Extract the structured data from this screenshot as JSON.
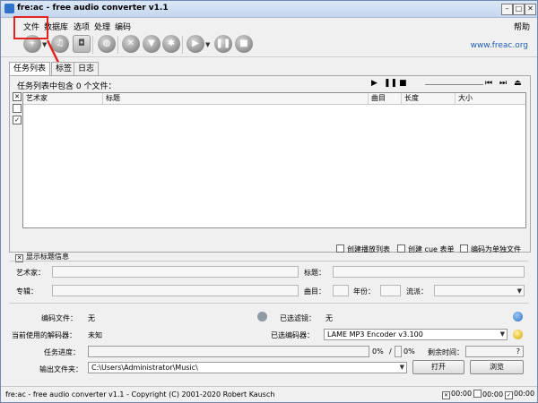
{
  "window": {
    "title": "fre:ac - free audio converter v1.1"
  },
  "menu": {
    "file": "文件",
    "database": "数据库",
    "options": "选项",
    "process": "处理",
    "encode": "编码",
    "help": "帮助"
  },
  "toolbar": {
    "website": "www.freac.org"
  },
  "tabs": {
    "joblist": "任务列表",
    "tags": "标签",
    "log": "日志"
  },
  "joblist": {
    "status": "任务列表中包含 0 个文件：",
    "columns": {
      "artist": "艺术家",
      "title": "标题",
      "track": "曲目",
      "length": "长度",
      "size": "大小"
    },
    "options": {
      "playlist": "创建播放列表",
      "cue": "创建 cue 表单",
      "single": "编码为单独文件"
    }
  },
  "tag_info": {
    "header": "显示标题信息",
    "artist": "艺术家：",
    "title": "标题：",
    "album": "专辑：",
    "track": "曲目：",
    "year": "年份：",
    "genre": "流派："
  },
  "encoding": {
    "file_label": "编码文件：",
    "file_value": "无",
    "filter_label": "已选滤镜：",
    "filter_value": "无",
    "decoder_label": "当前使用的解码器：",
    "decoder_value": "未知",
    "encoder_label": "已选编码器：",
    "encoder_value": "LAME MP3 Encoder v3.100",
    "progress_label": "任务进度：",
    "percent1": "0%",
    "percent2": "0%",
    "remaining_label": "剩余时间：",
    "remaining_value": "?",
    "output_label": "输出文件夹：",
    "output_value": "C:\\Users\\Administrator\\Music\\",
    "open_button": "打开",
    "browse_button": "浏览"
  },
  "statusbar": {
    "text": "fre:ac - free audio converter v1.1 - Copyright (C) 2001-2020 Robert Kausch",
    "time1": "00:00",
    "time2": "00:00",
    "time3": "00:00"
  },
  "icons": [
    "add-icon",
    "cd-icon",
    "lock-icon",
    "globe-icon",
    "tools-icon",
    "filter-icon",
    "gear-icon",
    "play-icon",
    "pause-icon",
    "stop-icon"
  ],
  "colors": {
    "annotation": "#e52222",
    "link": "#1f5fb5"
  }
}
